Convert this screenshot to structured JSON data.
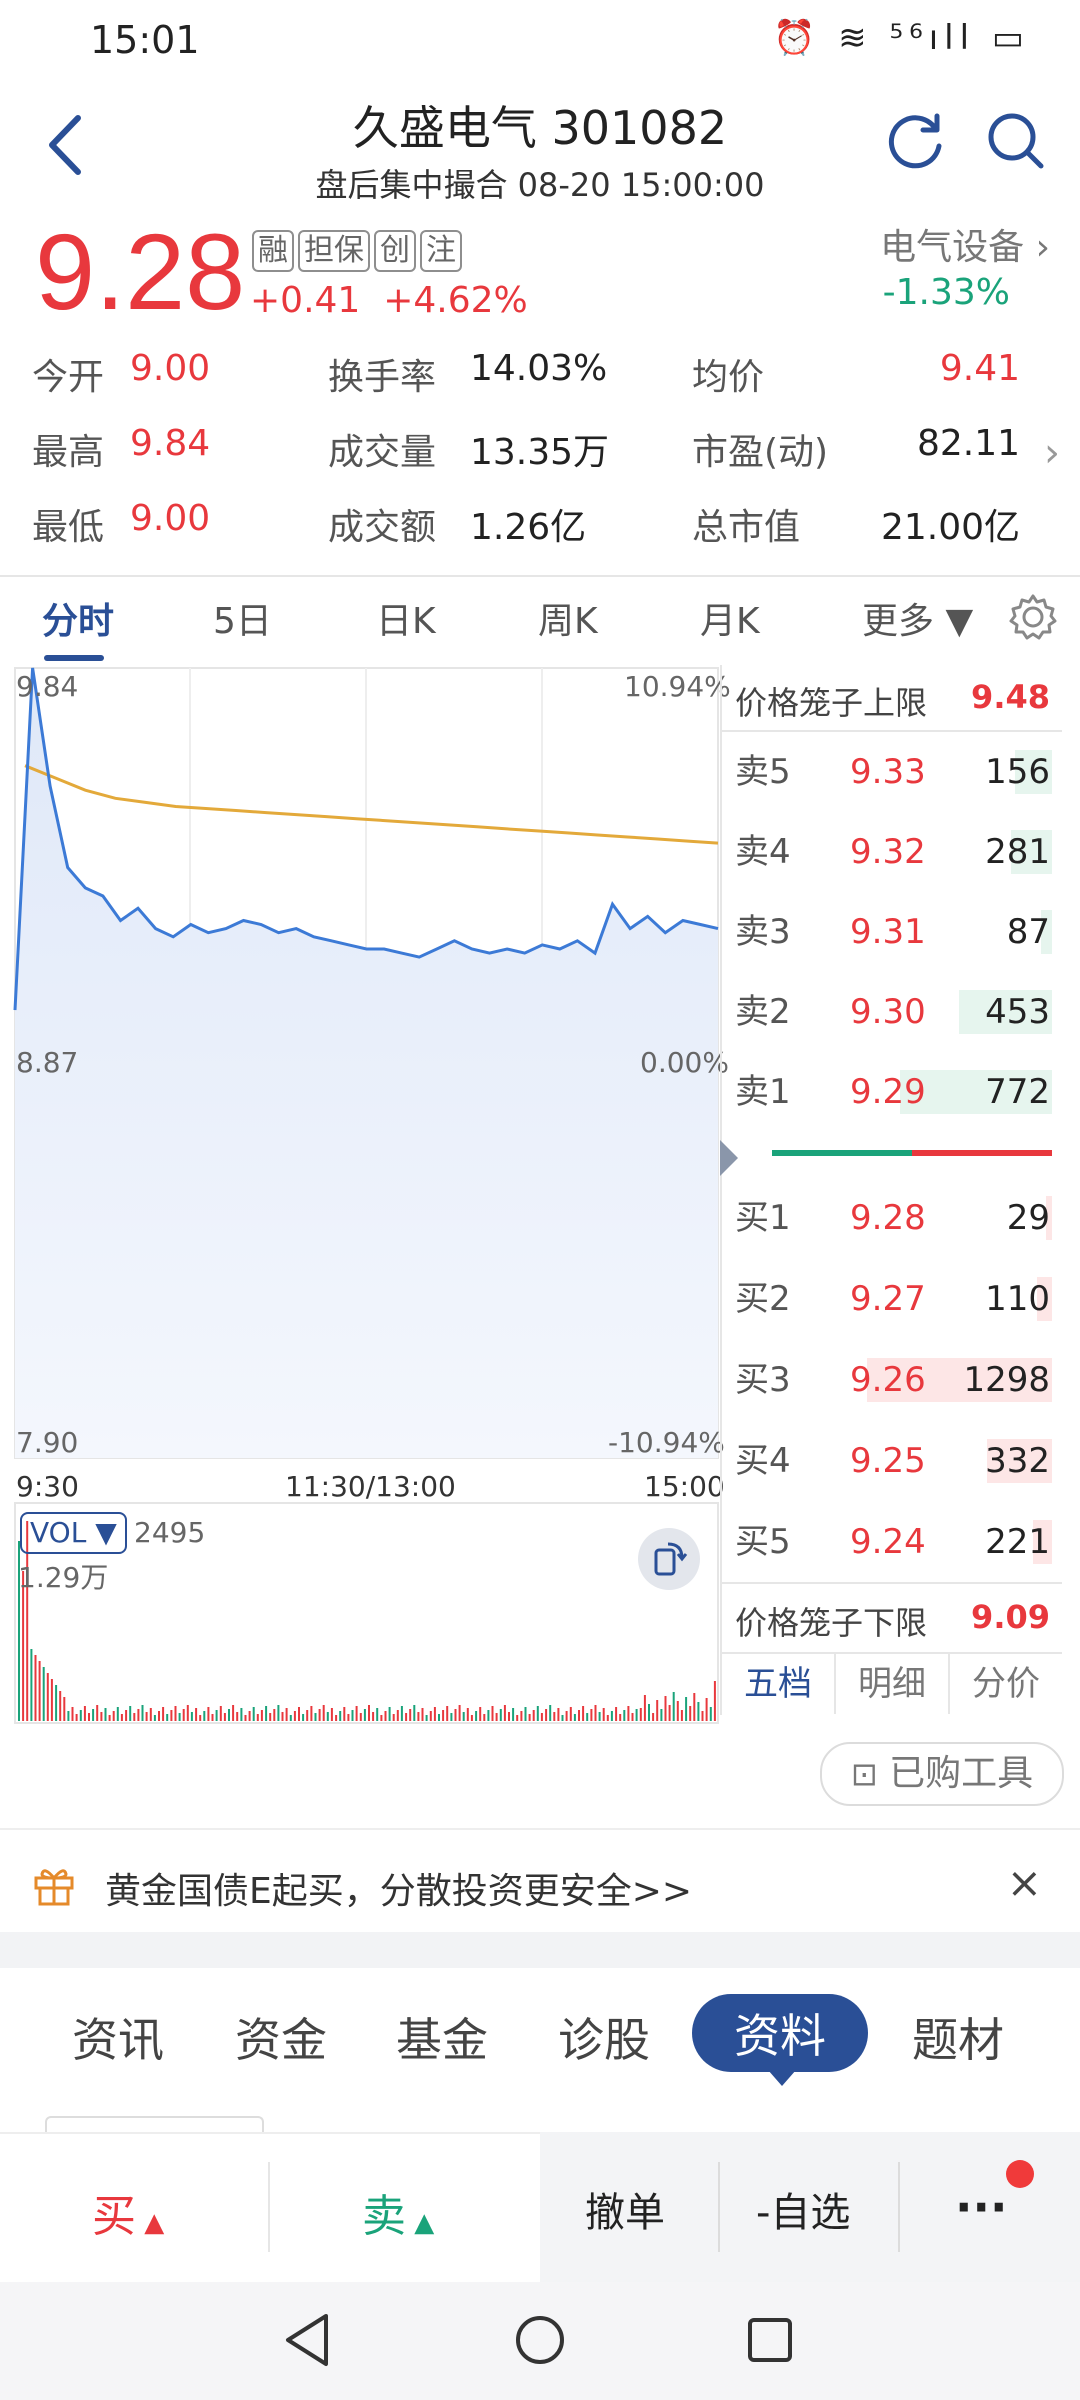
{
  "status_bar": {
    "time": "15:01",
    "icons": "⏰ ≋ ⁵⁶ıll ▭"
  },
  "header": {
    "title": "久盛电气 301082",
    "subtitle": "盘后集中撮合 08-20 15:00:00"
  },
  "quote": {
    "price": "9.28",
    "change": "+0.41",
    "change_pct": "+4.62%",
    "badges": [
      "融",
      "担保",
      "创",
      "注"
    ],
    "sector_name": "电气设备",
    "sector_change": "-1.33%"
  },
  "stats": [
    {
      "k": "今开",
      "v": "9.00",
      "color": "#e8383d"
    },
    {
      "k": "换手率",
      "v": "14.03%",
      "color": "#222222"
    },
    {
      "k": "均价",
      "v": "9.41",
      "color": "#e8383d"
    },
    {
      "k": "最高",
      "v": "9.84",
      "color": "#e8383d"
    },
    {
      "k": "成交量",
      "v": "13.35万",
      "color": "#222222"
    },
    {
      "k": "市盈(动)",
      "v": "82.11",
      "color": "#222222"
    },
    {
      "k": "最低",
      "v": "9.00",
      "color": "#e8383d"
    },
    {
      "k": "成交额",
      "v": "1.26亿",
      "color": "#222222"
    },
    {
      "k": "总市值",
      "v": "21.00亿",
      "color": "#222222"
    }
  ],
  "chart_tabs": [
    "分时",
    "5日",
    "日K",
    "周K",
    "月K",
    "更多 ▼"
  ],
  "chart": {
    "y_top": "9.84",
    "y_mid": "8.87",
    "y_bot": "7.90",
    "pct_top": "10.94%",
    "pct_mid": "0.00%",
    "pct_bot": "-10.94%",
    "x_start": "9:30",
    "x_mid": "11:30/13:00",
    "x_end": "15:00",
    "vol_selector": "VOL ▼",
    "vol_last": "2495",
    "vol_max": "1.29万"
  },
  "chart_data": {
    "type": "line",
    "x_range": [
      "9:30",
      "15:00"
    ],
    "ylim": [
      7.9,
      9.84
    ],
    "series": [],
    "price_points": [
      9.0,
      9.84,
      9.55,
      9.35,
      9.3,
      9.28,
      9.22,
      9.25,
      9.2,
      9.18,
      9.21,
      9.19,
      9.2,
      9.22,
      9.21,
      9.19,
      9.2,
      9.18,
      9.17,
      9.16,
      9.15,
      9.15,
      9.14,
      9.13,
      9.15,
      9.17,
      9.15,
      9.14,
      9.15,
      9.14,
      9.16,
      9.15,
      9.17,
      9.14,
      9.26,
      9.2,
      9.23,
      9.19,
      9.22,
      9.21,
      9.2
    ],
    "avg_points": [
      9.6,
      9.57,
      9.54,
      9.52,
      9.51,
      9.5,
      9.495,
      9.49,
      9.485,
      9.48,
      9.475,
      9.47,
      9.465,
      9.46,
      9.455,
      9.45,
      9.445,
      9.44,
      9.435,
      9.43,
      9.425,
      9.42,
      9.415,
      9.41
    ]
  },
  "order_book": {
    "upper_limit_label": "价格笼子上限",
    "upper_limit": "9.48",
    "asks": [
      {
        "label": "卖5",
        "price": "9.33",
        "vol": "156",
        "frac": 0.2
      },
      {
        "label": "卖4",
        "price": "9.32",
        "vol": "281",
        "frac": 0.22
      },
      {
        "label": "卖3",
        "price": "9.31",
        "vol": "87",
        "frac": 0.06
      },
      {
        "label": "卖2",
        "price": "9.30",
        "vol": "453",
        "frac": 0.5
      },
      {
        "label": "卖1",
        "price": "9.29",
        "vol": "772",
        "frac": 0.82
      }
    ],
    "bids": [
      {
        "label": "买1",
        "price": "9.28",
        "vol": "29",
        "frac": 0.03
      },
      {
        "label": "买2",
        "price": "9.27",
        "vol": "110",
        "frac": 0.08
      },
      {
        "label": "买3",
        "price": "9.26",
        "vol": "1298",
        "frac": 1.0
      },
      {
        "label": "买4",
        "price": "9.25",
        "vol": "332",
        "frac": 0.35
      },
      {
        "label": "买5",
        "price": "9.24",
        "vol": "221",
        "frac": 0.1
      }
    ],
    "lower_limit_label": "价格笼子下限",
    "lower_limit": "9.09",
    "tabs": [
      "五档",
      "明细",
      "分价"
    ]
  },
  "tools_button": "已购工具",
  "promo": {
    "text": "黄金国债E起买，分散投资更安全>>"
  },
  "categories": [
    "资讯",
    "资金",
    "基金",
    "诊股",
    "资料",
    "题材"
  ],
  "bottom_actions": {
    "buy": "买",
    "sell": "卖",
    "cancel": "撤单",
    "watch": "-自选",
    "more": "···"
  },
  "colors": {
    "up": "#e8383d",
    "down": "#1aa37a",
    "accent": "#2a4f96",
    "avg_line": "#e3a93a",
    "price_line": "#3c7ad6"
  }
}
